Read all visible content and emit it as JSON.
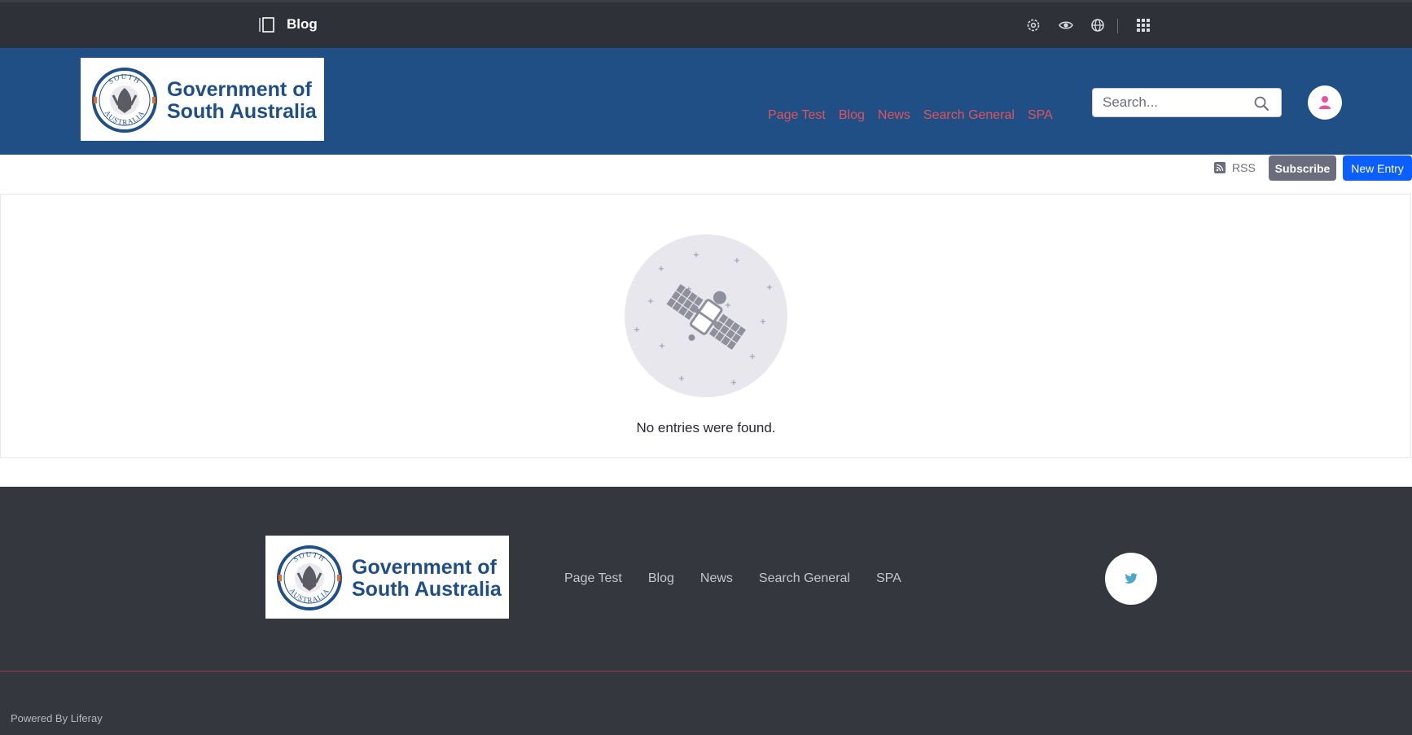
{
  "control_bar": {
    "page_title": "Blog",
    "icons": [
      "panel-toggle-icon",
      "gear-icon",
      "eye-icon",
      "globe-icon",
      "apps-grid-icon"
    ]
  },
  "header": {
    "logo": {
      "line1": "Government of",
      "line2": "South Australia",
      "seal_top": "SOUTH",
      "seal_bottom": "AUSTRALIA"
    },
    "nav": [
      "Page Test",
      "Blog",
      "News",
      "Search General",
      "SPA"
    ],
    "search": {
      "placeholder": "Search..."
    }
  },
  "toolbar": {
    "rss_label": "RSS",
    "subscribe_label": "Subscribe",
    "new_entry_label": "New Entry"
  },
  "content": {
    "empty_message": "No entries were found."
  },
  "footer": {
    "logo": {
      "line1": "Government of",
      "line2": "South Australia",
      "seal_top": "SOUTH",
      "seal_bottom": "AUSTRALIA"
    },
    "nav": [
      "Page Test",
      "Blog",
      "News",
      "Search General",
      "SPA"
    ],
    "powered_by": "Powered By Liferay"
  },
  "colors": {
    "control_bar": "#2f3139",
    "header": "#1f4f85",
    "nav_link": "#e0535e",
    "primary_button": "#0b5fff",
    "secondary_button": "#6b6c7e",
    "footer": "#34373e",
    "twitter": "#4da7c8"
  }
}
